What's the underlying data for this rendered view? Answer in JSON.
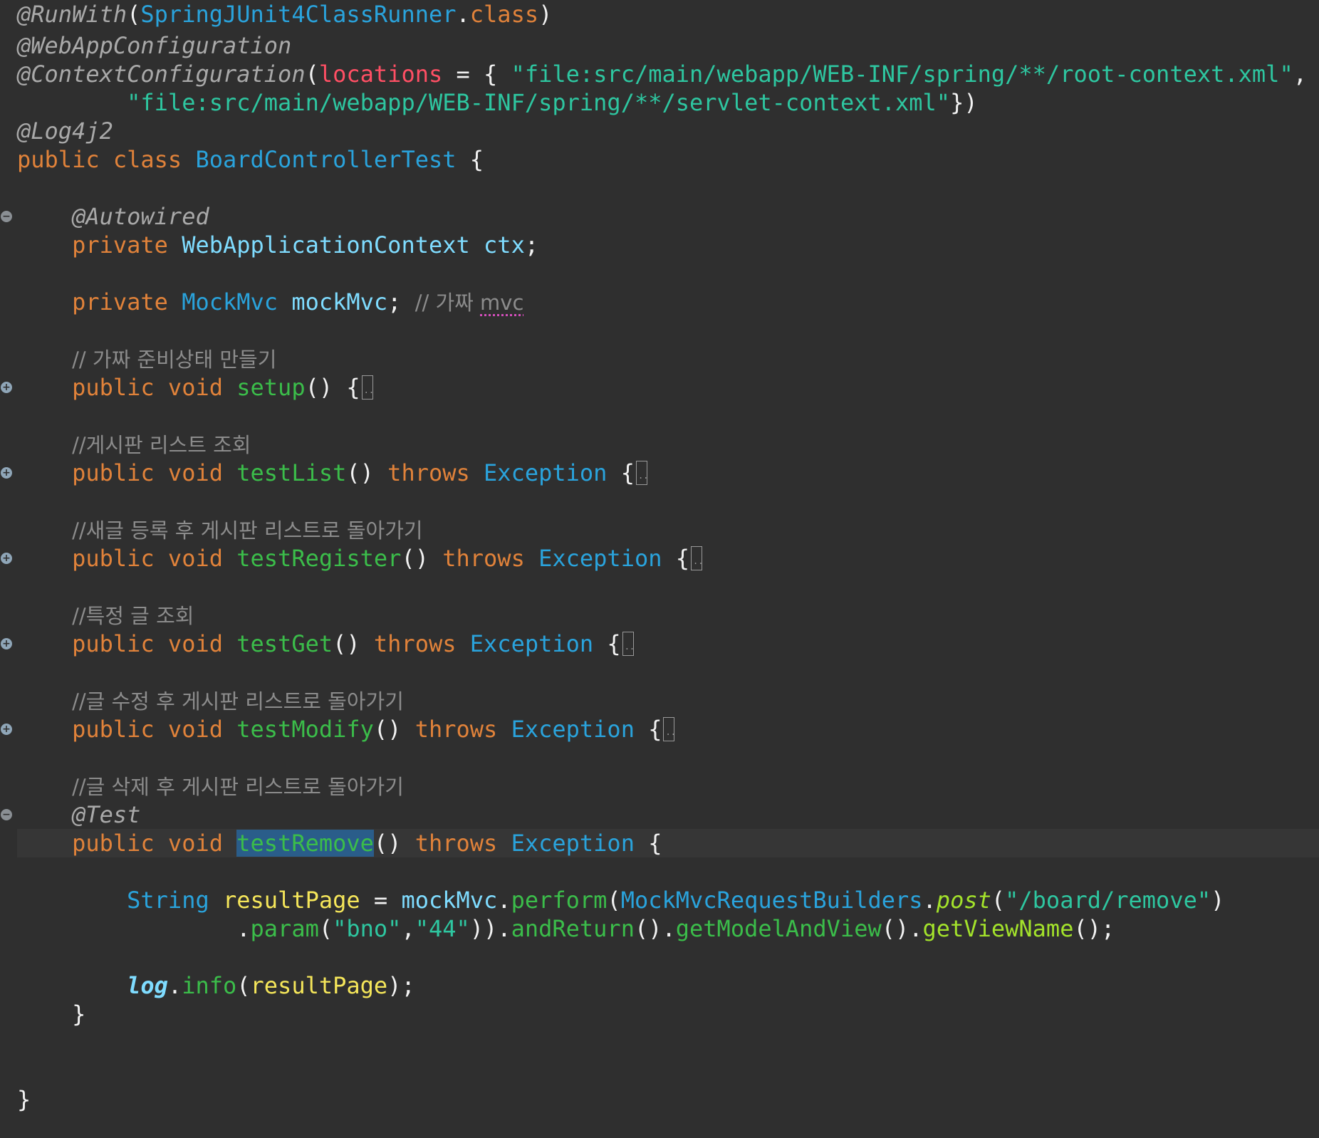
{
  "editor": {
    "annotations": {
      "run_with": "@RunWith",
      "runner_class": "SpringJUnit4ClassRunner",
      "dot_class": ".class",
      "web_app_config": "@WebAppConfiguration",
      "context_config": "@ContextConfiguration",
      "locations_attr": "locations",
      "root_context_path": "\"file:src/main/webapp/WEB-INF/spring/**/root-context.xml\"",
      "servlet_context_path": "\"file:src/main/webapp/WEB-INF/spring/**/servlet-context.xml\"",
      "log4j2": "@Log4j2",
      "autowired": "@Autowired",
      "test": "@Test"
    },
    "class_decl": {
      "modifiers": "public class",
      "name": "BoardControllerTest"
    },
    "fields": {
      "ctx_type": "WebApplicationContext",
      "ctx_name": "ctx",
      "mock_type": "MockMvc",
      "mock_name": "mockMvc",
      "mock_comment_prefix": "// 가짜 ",
      "mock_comment_word": "mvc"
    },
    "comments": {
      "setup": "// 가짜 준비상태 만들기",
      "list": "//게시판 리스트 조회",
      "register": "//새글 등록 후 게시판 리스트로 돌아가기",
      "get": "//특정 글 조회",
      "modify": "//글 수정 후 게시판 리스트로 돌아가기",
      "remove": "//글 삭제 후 게시판 리스트로 돌아가기"
    },
    "methods": {
      "public_void": "public void",
      "throws": "throws",
      "exception": "Exception",
      "setup": "setup",
      "test_list": "testList",
      "test_register": "testRegister",
      "test_get": "testGet",
      "test_modify": "testModify",
      "test_remove": "testRemove"
    },
    "remove_body": {
      "string_type": "String",
      "result_var": "resultPage",
      "mock_ref": "mockMvc",
      "perform": "perform",
      "builders": "MockMvcRequestBuilders",
      "post": "post",
      "url": "\"/board/remove\"",
      "param": "param",
      "param_key": "\"bno\"",
      "param_val": "\"44\"",
      "and_return": "andReturn",
      "get_mav": "getModelAndView",
      "get_view_name": "getViewName",
      "log": "log",
      "info": "info",
      "result_arg": "resultPage"
    }
  }
}
